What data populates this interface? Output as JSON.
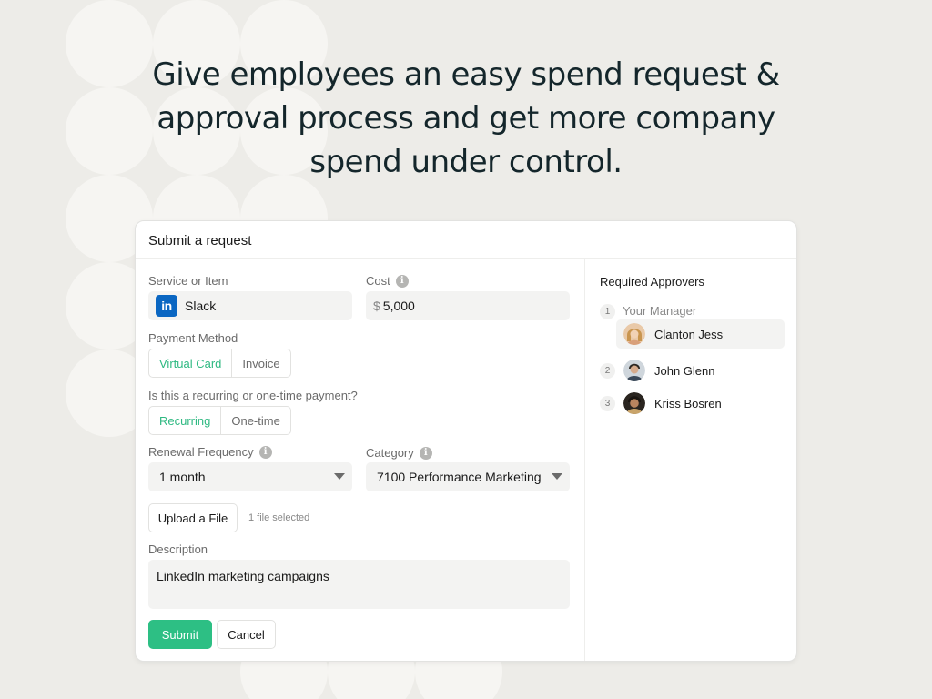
{
  "headline": {
    "line1": "Give employees an easy spend request &",
    "line2": "approval process and get more company",
    "line3": "spend under control."
  },
  "form": {
    "title": "Submit a request",
    "service": {
      "label": "Service or Item",
      "value": "Slack",
      "icon": "linkedin-icon",
      "icon_text": "in"
    },
    "cost": {
      "label": "Cost",
      "currency": "$",
      "value": "5,000"
    },
    "payment_method": {
      "label": "Payment Method",
      "options": [
        "Virtual Card",
        "Invoice"
      ],
      "selected": "Virtual Card"
    },
    "recurring": {
      "label": "Is this a recurring or one-time payment?",
      "options": [
        "Recurring",
        "One-time"
      ],
      "selected": "Recurring"
    },
    "renewal": {
      "label": "Renewal Frequency",
      "value": "1 month"
    },
    "category": {
      "label": "Category",
      "value": "7100 Performance Marketing"
    },
    "upload": {
      "button": "Upload a File",
      "status": "1 file selected"
    },
    "description": {
      "label": "Description",
      "value": "LinkedIn marketing campaigns"
    },
    "submit_label": "Submit",
    "cancel_label": "Cancel"
  },
  "approvers": {
    "title": "Required Approvers",
    "steps": [
      {
        "num": "1",
        "role": "Your Manager",
        "name": "Clanton Jess"
      },
      {
        "num": "2",
        "name": "John Glenn"
      },
      {
        "num": "3",
        "name": "Kriss Bosren"
      }
    ]
  },
  "colors": {
    "accent": "#2dbf84",
    "active_text": "#2fb982",
    "heading": "#14262b",
    "background": "#edece8",
    "linkedin": "#0a66c2"
  }
}
